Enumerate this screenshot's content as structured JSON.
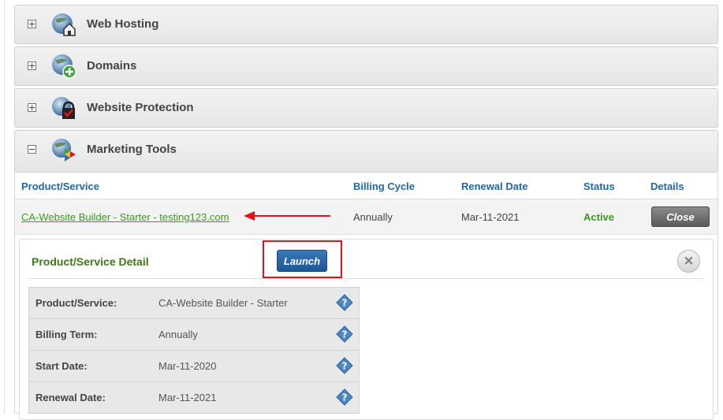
{
  "categories": [
    {
      "label": "Web Hosting",
      "toggle": "+"
    },
    {
      "label": "Domains",
      "toggle": "+"
    },
    {
      "label": "Website Protection",
      "toggle": "+"
    },
    {
      "label": "Marketing Tools",
      "toggle": "−"
    }
  ],
  "table": {
    "headers": {
      "product": "Product/Service",
      "billing": "Billing Cycle",
      "renewal": "Renewal Date",
      "status": "Status",
      "details": "Details"
    },
    "row": {
      "product": "CA-Website Builder - Starter - testing123.com",
      "billing": "Annually",
      "renewal": "Mar-11-2021",
      "status": "Active",
      "close_label": "Close"
    }
  },
  "detail": {
    "title": "Product/Service Detail",
    "launch_label": "Launch",
    "close_icon": "×",
    "fields": [
      {
        "label": "Product/Service:",
        "value": "CA-Website Builder - Starter"
      },
      {
        "label": "Billing Term:",
        "value": "Annually"
      },
      {
        "label": "Start Date:",
        "value": "Mar-11-2020"
      },
      {
        "label": "Renewal Date:",
        "value": "Mar-11-2021"
      }
    ]
  },
  "colors": {
    "link_green": "#3a9a1e",
    "header_blue": "#2267a6",
    "highlight_red": "#e0151b",
    "launch_blue": "#1d5796"
  },
  "icons": [
    "globe-house-icon",
    "globe-plus-icon",
    "globe-lock-icon",
    "globe-play-icon",
    "question-diamond-icon",
    "close-circle-icon",
    "red-arrow-icon"
  ]
}
